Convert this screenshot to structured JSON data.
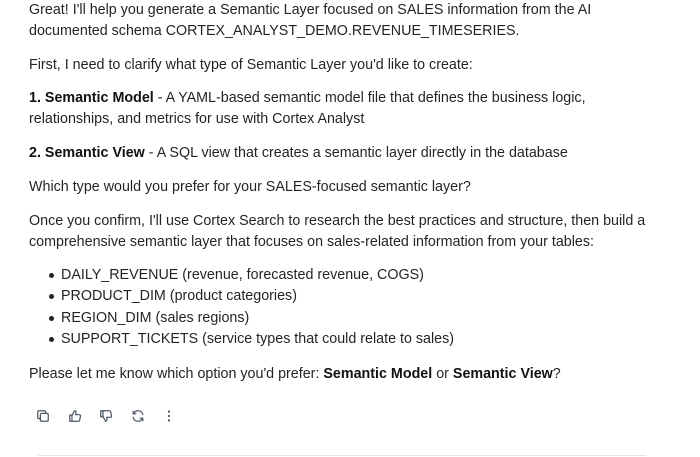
{
  "message": {
    "intro": "Great! I'll help you generate a Semantic Layer focused on SALES information from the AI documented schema CORTEX_ANALYST_DEMO.REVENUE_TIMESERIES.",
    "first": "First, I need to clarify what type of Semantic Layer you'd like to create:",
    "option1": {
      "number": "1. ",
      "title": "Semantic Model",
      "desc": " - A YAML-based semantic model file that defines the business logic, relationships, and metrics for use with Cortex Analyst"
    },
    "option2": {
      "number": "2. ",
      "title": "Semantic View",
      "desc": " - A SQL view that creates a semantic layer directly in the database"
    },
    "which": "Which type would you prefer for your SALES-focused semantic layer?",
    "once": "Once you confirm, I'll use Cortex Search to research the best practices and structure, then build a comprehensive semantic layer that focuses on sales-related information from your tables:",
    "tables": [
      "DAILY_REVENUE (revenue, forecasted revenue, COGS)",
      "PRODUCT_DIM (product categories)",
      "REGION_DIM (sales regions)",
      "SUPPORT_TICKETS (service types that could relate to sales)"
    ],
    "please": {
      "prefix": "Please let me know which option you'd prefer: ",
      "opt1": "Semantic Model",
      "or": " or ",
      "opt2": "Semantic View",
      "suffix": "?"
    }
  },
  "actions": [
    {
      "name": "copy-icon"
    },
    {
      "name": "thumbs-up-icon"
    },
    {
      "name": "thumbs-down-icon"
    },
    {
      "name": "regenerate-icon"
    },
    {
      "name": "more-options-icon"
    }
  ],
  "colors": {
    "text": "#1f2328",
    "icon": "#4b5563",
    "divider": "#e3e5e8"
  }
}
